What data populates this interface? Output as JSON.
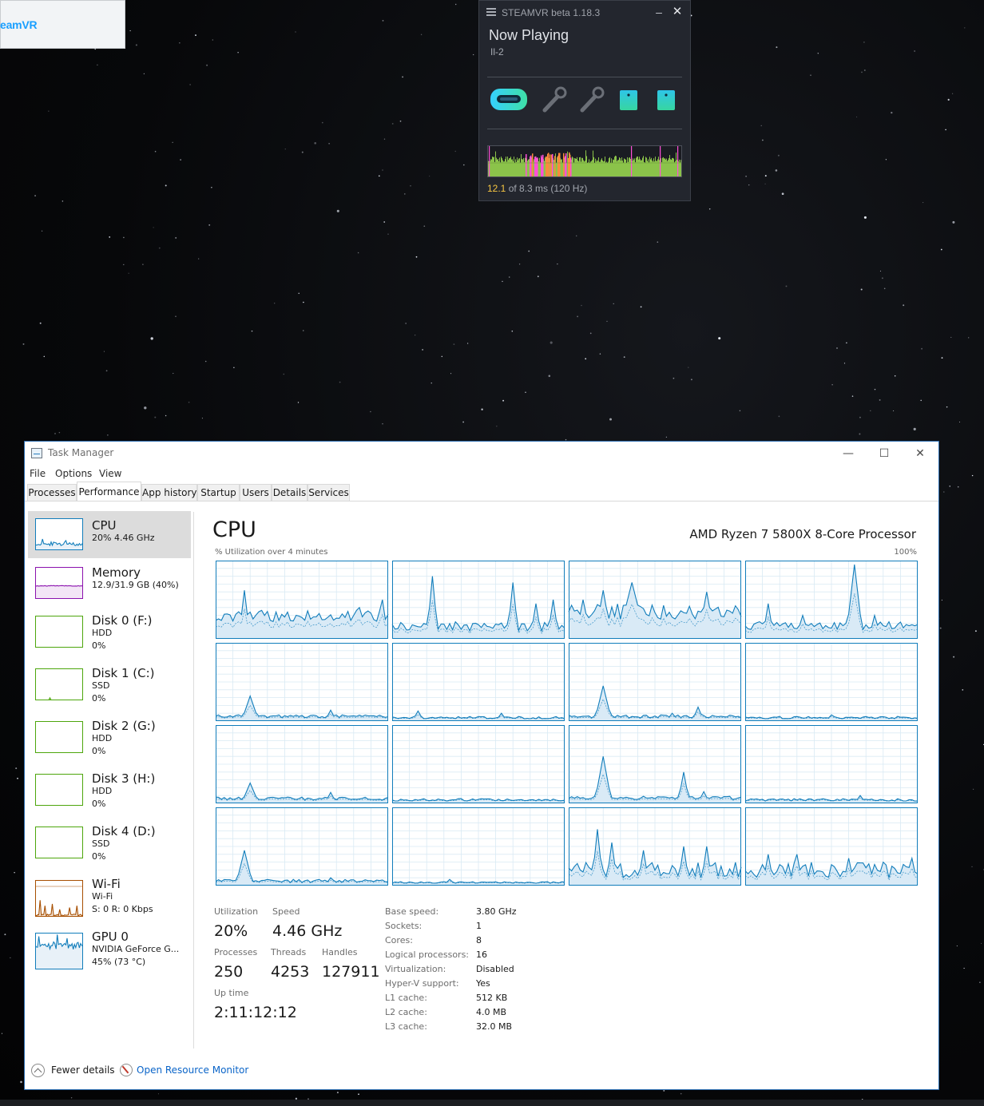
{
  "desktop": {
    "corner_window_text": "eamVR"
  },
  "steamvr": {
    "title": "STEAMVR beta 1.18.3",
    "now_playing_label": "Now Playing",
    "game": "Il-2",
    "devices": [
      "headset-icon",
      "controller-left-icon",
      "controller-right-icon",
      "base-station-1-icon",
      "base-station-2-icon"
    ],
    "frame_time_value": "12.1",
    "frame_time_rest": "of 8.3 ms (120 Hz)",
    "colors": {
      "background": "#23262e",
      "graph_green": "#8bc34a",
      "graph_pink": "#ff4fd8",
      "graph_orange": "#ff8a3d",
      "accent_cyan": "#2ec5e8"
    }
  },
  "taskmanager": {
    "title": "Task Manager",
    "window_buttons": {
      "minimize": "—",
      "maximize": "☐",
      "close": "✕"
    },
    "menu": [
      "File",
      "Options",
      "View"
    ],
    "tabs": [
      "Processes",
      "Performance",
      "App history",
      "Startup",
      "Users",
      "Details",
      "Services"
    ],
    "active_tab": "Performance",
    "sidebar": [
      {
        "name": "CPU",
        "line1": "20% 4.46 GHz",
        "line2": "",
        "kind": "cpu",
        "color": "#117dbb"
      },
      {
        "name": "Memory",
        "line1": "12.9/31.9 GB (40%)",
        "line2": "",
        "kind": "memory",
        "color": "#8b12ae"
      },
      {
        "name": "Disk 0 (F:)",
        "line1": "HDD",
        "line2": "0%",
        "kind": "disk",
        "color": "#4da60c"
      },
      {
        "name": "Disk 1 (C:)",
        "line1": "SSD",
        "line2": "0%",
        "kind": "disk",
        "color": "#4da60c"
      },
      {
        "name": "Disk 2 (G:)",
        "line1": "HDD",
        "line2": "0%",
        "kind": "disk",
        "color": "#4da60c"
      },
      {
        "name": "Disk 3 (H:)",
        "line1": "HDD",
        "line2": "0%",
        "kind": "disk",
        "color": "#4da60c"
      },
      {
        "name": "Disk 4 (D:)",
        "line1": "SSD",
        "line2": "0%",
        "kind": "disk",
        "color": "#4da60c"
      },
      {
        "name": "Wi-Fi",
        "line1": "Wi-Fi",
        "line2": "S: 0 R: 0 Kbps",
        "kind": "wifi",
        "color": "#a74f01"
      },
      {
        "name": "GPU 0",
        "line1": "NVIDIA GeForce G...",
        "line2": "45% (73 °C)",
        "kind": "gpu",
        "color": "#117dbb"
      }
    ],
    "cpu_panel": {
      "heading": "CPU",
      "model": "AMD Ryzen 7 5800X 8-Core Processor",
      "graph_label": "% Utilization over 4 minutes",
      "graph_max_label": "100%",
      "logical_graph_count": 16,
      "stats": {
        "utilization_label": "Utilization",
        "utilization": "20%",
        "speed_label": "Speed",
        "speed": "4.46 GHz",
        "processes_label": "Processes",
        "processes": "250",
        "threads_label": "Threads",
        "threads": "4253",
        "handles_label": "Handles",
        "handles": "127911",
        "uptime_label": "Up time",
        "uptime": "2:11:12:12"
      },
      "specs": [
        {
          "key": "Base speed:",
          "value": "3.80 GHz"
        },
        {
          "key": "Sockets:",
          "value": "1"
        },
        {
          "key": "Cores:",
          "value": "8"
        },
        {
          "key": "Logical processors:",
          "value": "16"
        },
        {
          "key": "Virtualization:",
          "value": "Disabled"
        },
        {
          "key": "Hyper-V support:",
          "value": "Yes"
        },
        {
          "key": "L1 cache:",
          "value": "512 KB"
        },
        {
          "key": "L2 cache:",
          "value": "4.0 MB"
        },
        {
          "key": "L3 cache:",
          "value": "32.0 MB"
        }
      ]
    },
    "footer": {
      "fewer_details": "Fewer details",
      "open_resource_monitor": "Open Resource Monitor"
    },
    "colors": {
      "cpu_line": "#117dbb",
      "cpu_fill": "#d9eaf6",
      "cpu_grid": "#d9eaf4",
      "link": "#0a64c8"
    }
  }
}
